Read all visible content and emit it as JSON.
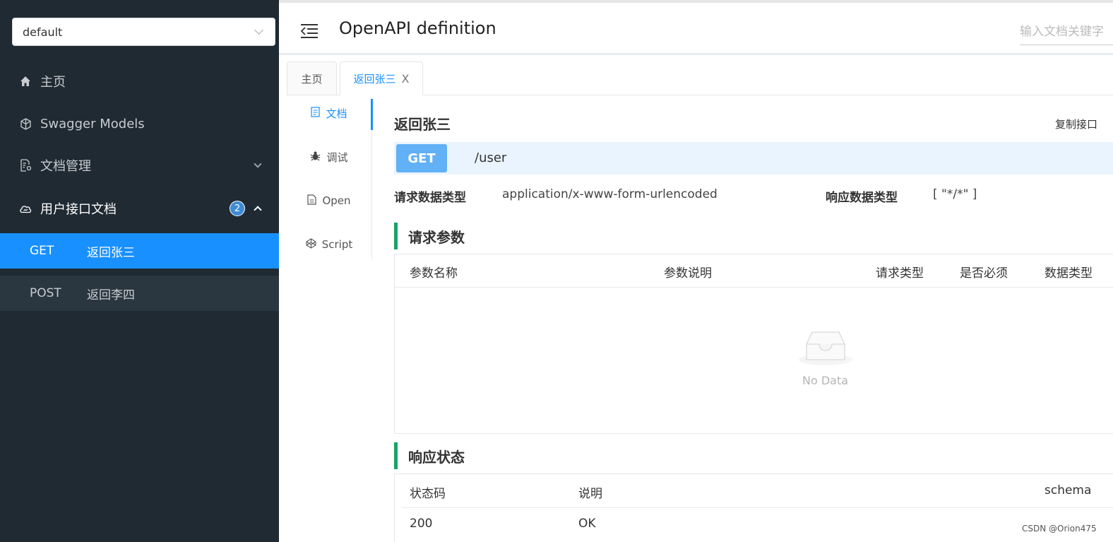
{
  "sidebar": {
    "group_select": {
      "value": "default"
    },
    "menu": [
      {
        "label": "主页",
        "icon": "home-icon"
      },
      {
        "label": "Swagger Models",
        "icon": "cube-icon"
      },
      {
        "label": "文档管理",
        "icon": "document-settings-icon"
      },
      {
        "label": "用户接口文档",
        "icon": "cloud-icon",
        "badge": "2"
      }
    ],
    "sub_items": [
      {
        "method": "GET",
        "label": "返回张三",
        "active": true
      },
      {
        "method": "POST",
        "label": "返回李四",
        "active": false
      }
    ]
  },
  "header": {
    "title": "OpenAPI definition",
    "search_placeholder": "输入文档关键字"
  },
  "tabs": [
    {
      "label": "主页"
    },
    {
      "label": "返回张三",
      "close": "X"
    }
  ],
  "doc_nav": [
    {
      "label": "文档",
      "icon": "doc-icon"
    },
    {
      "label": "调试",
      "icon": "bug-icon"
    },
    {
      "label": "Open",
      "icon": "file-icon"
    },
    {
      "label": "Script",
      "icon": "codepen-icon"
    }
  ],
  "api": {
    "title": "返回张三",
    "copy_label": "复制接口",
    "method": "GET",
    "path": "/user",
    "request_type_label": "请求数据类型",
    "request_type_value": "application/x-www-form-urlencoded",
    "response_type_label": "响应数据类型",
    "response_type_value": "[ \"*/*\" ]"
  },
  "request_params": {
    "title": "请求参数",
    "columns": [
      "参数名称",
      "参数说明",
      "请求类型",
      "是否必须",
      "数据类型"
    ],
    "empty_text": "No Data"
  },
  "response_status": {
    "title": "响应状态",
    "columns": [
      "状态码",
      "说明",
      "schema"
    ],
    "rows": [
      {
        "code": "200",
        "desc": "OK"
      }
    ]
  },
  "watermark": "CSDN @Orion475",
  "colors": {
    "accent": "#1890ff",
    "sidebar_bg": "#1f2a33",
    "method_get": "#62b0f5",
    "section_bar": "#1aa363"
  }
}
